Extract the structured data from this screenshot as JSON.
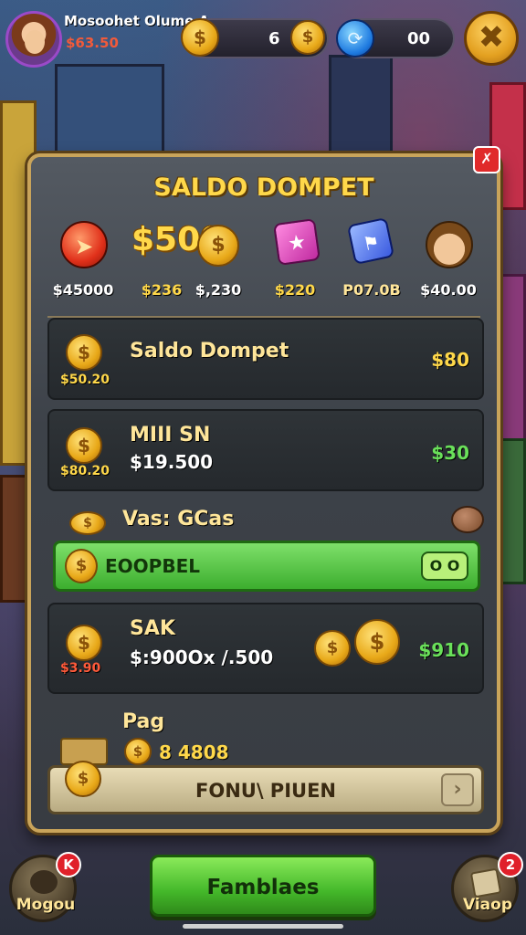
{
  "player": {
    "name": "Mosoohet Olume A",
    "cash": "$63.50"
  },
  "resources": {
    "gold_value": "6",
    "gem_value": "00"
  },
  "panel": {
    "title": "SALDO DOMPET",
    "icons": [
      {
        "icon": "red-arrow-coin-icon",
        "label": "$45000"
      },
      {
        "icon": "gold-500-coins-icon",
        "label": "$236",
        "big": "$500"
      },
      {
        "icon": "coin-icon",
        "label": "$,230"
      },
      {
        "icon": "pink-ticket-icon",
        "label": "$220"
      },
      {
        "icon": "blue-card-icon",
        "label": "P07.0B"
      },
      {
        "icon": "character-avatar-icon",
        "label": "$40.00"
      }
    ],
    "rows": [
      {
        "title": "Saldo Dompet",
        "stack_label": "$50.20",
        "amount": "$80",
        "amount_color": "#ffd84a"
      },
      {
        "title": "MIII SN",
        "sub": "$19.500",
        "stack_label": "$80.20",
        "amount": "$30",
        "amount_color": "#6ae05a"
      }
    ],
    "vas_label": "Vas: GCas",
    "green_bar": {
      "label": "EOOPBEL",
      "toggle": "O O"
    },
    "sak_row": {
      "title": "SAK",
      "sub": "$:900Ox /.500",
      "stack_label": "$3.90",
      "amount": "$910",
      "amount_color": "#6ae05a"
    },
    "pag_label": "Pag",
    "pag_value": "8 4808",
    "form_button": "FONU\\ PIUEN"
  },
  "bottom": {
    "left_label": "Mogou",
    "left_badge": "K",
    "main_button": "Famblaes",
    "right_label": "Viaop",
    "right_badge": "2"
  },
  "colors": {
    "panel_border": "#c9a45a",
    "title_gold": "#ffd84a",
    "green_button": "#44b82a",
    "badge_red": "#e0202a"
  }
}
